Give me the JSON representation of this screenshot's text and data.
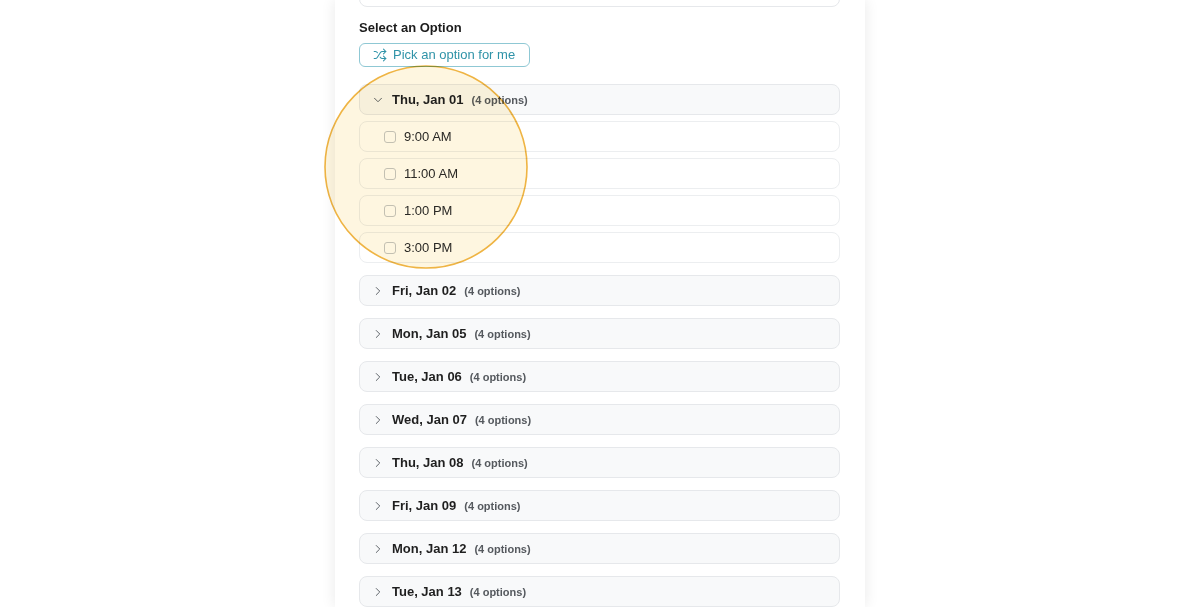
{
  "section_title": "Select an Option",
  "pick_button": {
    "label": "Pick an option for me"
  },
  "groups": [
    {
      "date": "Thu, Jan 01",
      "count": "(4 options)",
      "expanded": true,
      "highlighted": true,
      "options": [
        {
          "time": "9:00 AM",
          "checked": false
        },
        {
          "time": "11:00 AM",
          "checked": false
        },
        {
          "time": "1:00 PM",
          "checked": false
        },
        {
          "time": "3:00 PM",
          "checked": false
        }
      ]
    },
    {
      "date": "Fri, Jan 02",
      "count": "(4 options)",
      "expanded": false,
      "highlighted": false
    },
    {
      "date": "Mon, Jan 05",
      "count": "(4 options)",
      "expanded": false,
      "highlighted": false
    },
    {
      "date": "Tue, Jan 06",
      "count": "(4 options)",
      "expanded": false,
      "highlighted": false
    },
    {
      "date": "Wed, Jan 07",
      "count": "(4 options)",
      "expanded": false,
      "highlighted": false
    },
    {
      "date": "Thu, Jan 08",
      "count": "(4 options)",
      "expanded": false,
      "highlighted": false
    },
    {
      "date": "Fri, Jan 09",
      "count": "(4 options)",
      "expanded": false,
      "highlighted": false
    },
    {
      "date": "Mon, Jan 12",
      "count": "(4 options)",
      "expanded": false,
      "highlighted": false
    },
    {
      "date": "Tue, Jan 13",
      "count": "(4 options)",
      "expanded": false,
      "highlighted": false
    }
  ]
}
